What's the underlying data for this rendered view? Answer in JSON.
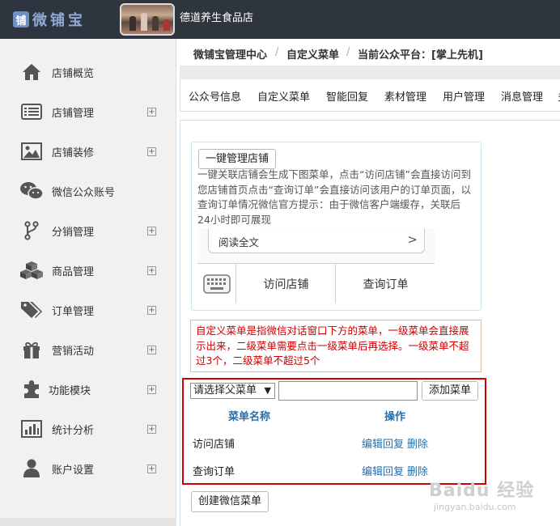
{
  "header": {
    "logo_char": "铺",
    "logo_text": "微铺宝",
    "shop_name": "德道养生食品店"
  },
  "sidebar": {
    "items": [
      {
        "label": "店铺概览",
        "icon": "home-icon",
        "expandable": false
      },
      {
        "label": "店铺管理",
        "icon": "list-icon",
        "expandable": true
      },
      {
        "label": "店铺装修",
        "icon": "picture-icon",
        "expandable": true
      },
      {
        "label": "微信公众账号",
        "icon": "wechat-icon",
        "expandable": false
      },
      {
        "label": "分销管理",
        "icon": "branch-icon",
        "expandable": true
      },
      {
        "label": "商品管理",
        "icon": "cubes-icon",
        "expandable": true
      },
      {
        "label": "订单管理",
        "icon": "tags-icon",
        "expandable": true
      },
      {
        "label": "营销活动",
        "icon": "gift-icon",
        "expandable": true
      },
      {
        "label": "功能模块",
        "icon": "puzzle-icon",
        "expandable": true
      },
      {
        "label": "统计分析",
        "icon": "bar-chart-icon",
        "expandable": true
      },
      {
        "label": "账户设置",
        "icon": "user-icon",
        "expandable": true
      }
    ],
    "expand_glyph": "+"
  },
  "breadcrumb": {
    "items": [
      "微铺宝管理中心",
      "自定义菜单",
      "当前公众平台：[掌上先机]"
    ],
    "separator": "/"
  },
  "tabs": [
    "公众号信息",
    "自定义菜单",
    "智能回复",
    "素材管理",
    "用户管理",
    "消息管理",
    "多"
  ],
  "preview": {
    "button_label": "一键管理店铺",
    "description": "一键关联店铺会生成下图菜单，点击“访问店铺”会直接访问到您店铺首页点击“查询订单”会直接访问该用户的订单页面，以查询订单情况微信官方提示：由于微信客户端缓存，关联后24小时即可展现",
    "read_all": "阅读全文",
    "read_all_chevron": ">",
    "menu_buttons": [
      "访问店铺",
      "查询订单"
    ]
  },
  "notice": "自定义菜单是指微信对话窗口下方的菜单，一级菜单会直接展示出来，二级菜单需要点击一级菜单后再选择。一级菜单不超过3个，二级菜单不超过5个",
  "editor": {
    "select_value": "请选择父菜单",
    "select_arrow": "▼",
    "input_value": "",
    "add_button": "添加菜单",
    "headers": {
      "name": "菜单名称",
      "ops": "操作"
    },
    "rows": [
      {
        "name": "访问店铺",
        "ops": [
          "编辑",
          "回复",
          "删除"
        ]
      },
      {
        "name": "查询订单",
        "ops": [
          "编辑",
          "回复",
          "删除"
        ]
      }
    ]
  },
  "create_button": "创建微信菜单",
  "watermark": {
    "main": "Baidu 经验",
    "sub": "jingyan.baidu.com"
  },
  "colors": {
    "topbar": "#2f353e",
    "link": "#2a6ea8",
    "notice_red": "#cc0000",
    "highlight_box": "#d40000"
  }
}
